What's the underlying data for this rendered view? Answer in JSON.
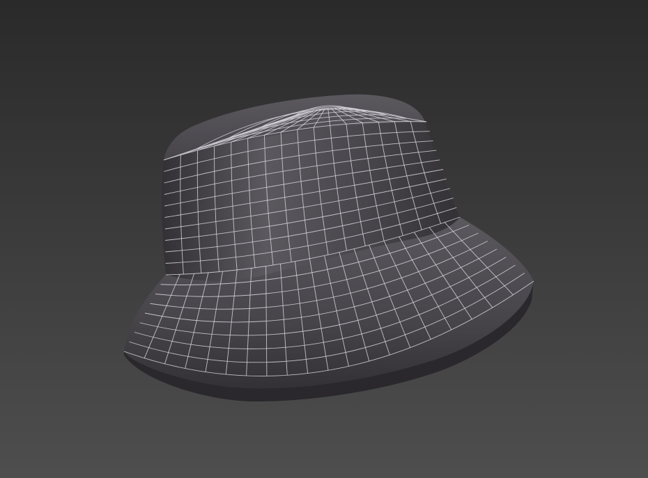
{
  "viewport": {
    "background": {
      "top": "#2a2a2a",
      "bottom": "#4e4e4e"
    },
    "model": {
      "name": "bucket-hat",
      "render_mode": "shaded-with-wireframe",
      "surface_color": "#47454a",
      "surface_highlight": "#5b585e",
      "surface_shadow": "#333135",
      "wire_color": "#d9d9df"
    }
  }
}
